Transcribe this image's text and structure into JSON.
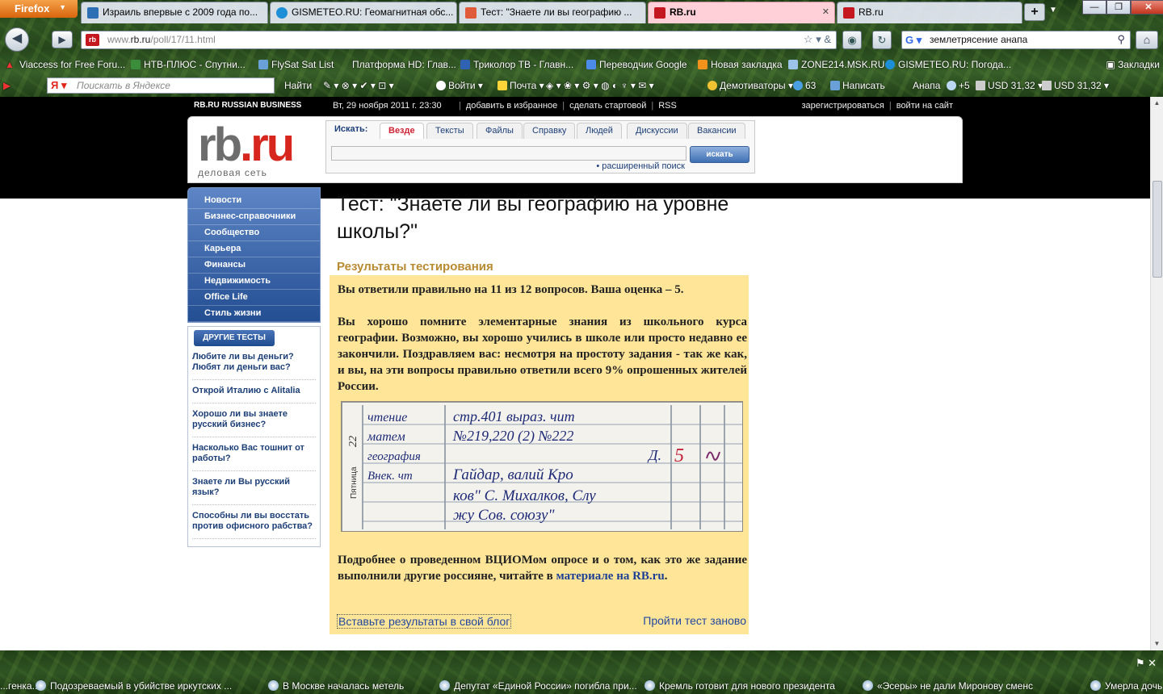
{
  "browser": {
    "app_button": "Firefox",
    "tabs": [
      {
        "title": "Израиль впервые с 2009 года по...",
        "favcolor": "#2d6fb5"
      },
      {
        "title": "GISMETEO.RU: Геомагнитная обс...",
        "favcolor": "#1c8fd6"
      },
      {
        "title": "Тест: \"Знаете ли вы географию ...",
        "favcolor": "#e05b3a"
      },
      {
        "title": "RB.ru",
        "favcolor": "#c4171f"
      },
      {
        "title": "RB.ru",
        "favcolor": "#c4171f"
      }
    ],
    "url_host": "www.",
    "url_domain": "rb.ru",
    "url_path": "/poll/17/11.html",
    "search_value": "землетрясение анапа",
    "bookmarks": [
      "Viaccess for Free Foru...",
      "НТВ-ПЛЮС - Спутни...",
      "FlySat Sat List",
      "Платформа HD: Глав...",
      "Триколор ТВ - Главн...",
      "Переводчик Google",
      "Новая закладка",
      "ZONE214.MSK.RU",
      "GISMETEO.RU: Погода..."
    ],
    "bookmarks_menu": "Закладки",
    "yandex_placeholder": "Поискать в Яндексе",
    "yandex_find": "Найти",
    "yandex_items": [
      "Войти",
      "Почта",
      "Демотиваторы",
      "63",
      "Написать",
      "Анапа",
      "+5",
      "USD 31,32",
      "USD 31,32"
    ]
  },
  "site": {
    "brand": "RB.RU RUSSIAN BUSINESS",
    "date": "Вт, 29 ноября 2011 г. 23:30",
    "top_links": [
      "добавить в избранное",
      "сделать стартовой",
      "RSS"
    ],
    "account_links": [
      "зарегистрироваться",
      "войти на сайт"
    ],
    "logo_tagline": "деловая сеть",
    "search_label": "Искать:",
    "search_tabs": [
      "Везде",
      "Тексты",
      "Файлы",
      "Справку",
      "Людей",
      "Дискуссии",
      "Вакансии"
    ],
    "search_button": "искать",
    "advanced_search": "• расширенный поиск",
    "nav": [
      "Новости",
      "Бизнес-справочники",
      "Сообщество",
      "Карьера",
      "Финансы",
      "Недвижимость",
      "Office Life",
      "Стиль жизни"
    ],
    "other_tests_title": "ДРУГИЕ ТЕСТЫ",
    "other_tests": [
      "Любите ли вы деньги? Любят ли деньги вас?",
      "Открой Италию с Alitalia",
      "Хорошо ли вы знаете русский бизнес?",
      "Насколько Вас тошнит от работы?",
      "Знаете ли Вы русский язык?",
      "Способны ли вы восстать против офисного рабства?"
    ]
  },
  "main": {
    "title": "Тест: \"Знаете ли вы географию на уровне школы?\"",
    "results_heading": "Результаты тестирования",
    "score_text": "Вы ответили правильно на 11 из 12 вопросов. Ваша оценка – 5.",
    "body_text": "Вы хорошо помните элементарные знания из школьного курса географии. Возможно, вы хорошо учились в школе или просто недавно ее закончили. Поздравляем вас: несмотря на простоту задания - так же как, и вы, на эти вопросы правильно ответили всего 9% опрошенных жителей России.",
    "more_text": "Подробнее о проведенном ВЦИОМом опросе и о том, как это же задание выполнили другие россияне, читайте в",
    "more_link": "материале на RB.ru",
    "more_end": ".",
    "embed_link": "Вставьте результаты в свой блог",
    "retry_link": "Пройти тест заново",
    "diary": {
      "day": "Пятница",
      "date_num": "22",
      "subjects": [
        "чтение",
        "матем",
        "география",
        "Внек. чт"
      ],
      "hw": [
        "стр.401 выраз. чит",
        "№219,220 (2) №222",
        "Д.",
        "Гайдар, валий Кро",
        "ков\" С. Михалков, Слу",
        "жу Сов. союзу\""
      ],
      "grade": "5"
    }
  },
  "ticker": [
    "...генка...",
    "Подозреваемый в убийстве иркутских ...",
    "В Москве началась метель",
    "Депутат «Единой России» погибла при...",
    "Кремль готовит для нового президента",
    "«Эсеры» не дали Миронову сменс",
    "Умерла дочь"
  ]
}
